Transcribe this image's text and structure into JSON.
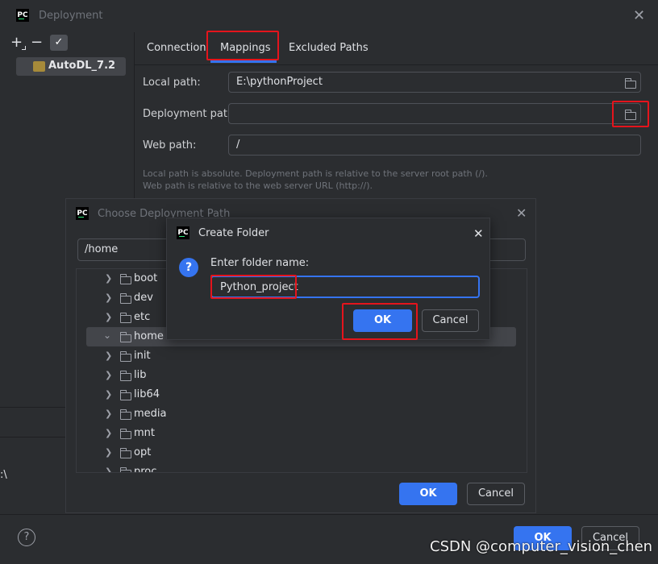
{
  "main_dialog": {
    "title": "Deployment",
    "close_icon": "close-icon",
    "toolbar": {
      "add": "+",
      "remove": "−",
      "check": "✓"
    },
    "server": {
      "name": "AutoDL_7.2",
      "icon": "sftp-server-icon"
    },
    "tabs": [
      {
        "label": "Connection"
      },
      {
        "label": "Mappings",
        "active": true
      },
      {
        "label": "Excluded Paths"
      }
    ],
    "fields": {
      "local_path": {
        "label": "Local path:",
        "value": "E:\\pythonProject"
      },
      "deployment_path": {
        "label": "Deployment path:",
        "value": ""
      },
      "web_path": {
        "label": "Web path:",
        "value": "/"
      }
    },
    "hint_line1": "Local path is absolute. Deployment path is relative to the server root path (/).",
    "hint_line2": "Web path is relative to the web server URL (http://).",
    "ok_label": "OK",
    "cancel_label": "Cancel",
    "help_label": "?"
  },
  "choose_dialog": {
    "title": "Choose Deployment Path",
    "path_value": "/home",
    "tree": [
      {
        "label": "boot",
        "expanded": false
      },
      {
        "label": "dev",
        "expanded": false
      },
      {
        "label": "etc",
        "expanded": false
      },
      {
        "label": "home",
        "expanded": true,
        "selected": true
      },
      {
        "label": "init",
        "expanded": false
      },
      {
        "label": "lib",
        "expanded": false
      },
      {
        "label": "lib64",
        "expanded": false
      },
      {
        "label": "media",
        "expanded": false
      },
      {
        "label": "mnt",
        "expanded": false
      },
      {
        "label": "opt",
        "expanded": false
      },
      {
        "label": "proc",
        "expanded": false
      }
    ],
    "ok_label": "OK",
    "cancel_label": "Cancel"
  },
  "create_folder_dialog": {
    "title": "Create Folder",
    "prompt": "Enter folder name:",
    "value": "Python_project",
    "ok_label": "OK",
    "cancel_label": "Cancel"
  },
  "left_fragment": ":\\",
  "watermark": "CSDN @computer_vision_chen",
  "colors": {
    "accent": "#3574f0",
    "highlight": "#e5141c",
    "background": "#2b2d30"
  }
}
